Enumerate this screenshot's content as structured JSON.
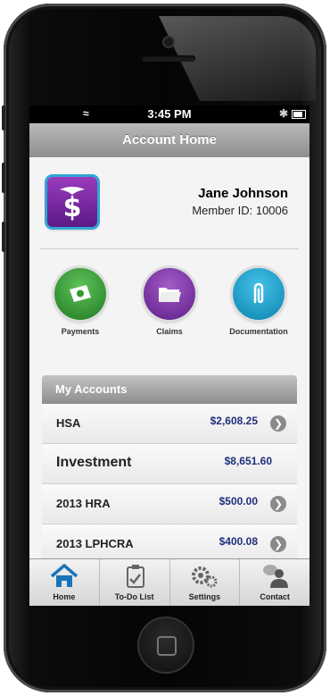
{
  "status_bar": {
    "time": "3:45 PM"
  },
  "nav": {
    "title": "Account Home"
  },
  "profile": {
    "name": "Jane Johnson",
    "member_id": "Member ID: 10006"
  },
  "actions": [
    {
      "label": "Payments",
      "icon": "payments-icon",
      "color": "#2f9b2e"
    },
    {
      "label": "Claims",
      "icon": "claims-icon",
      "color": "#7a2ea3"
    },
    {
      "label": "Documentation",
      "icon": "documentation-icon",
      "color": "#1a9fd0"
    }
  ],
  "accounts": {
    "header": "My Accounts",
    "rows": [
      {
        "name": "HSA",
        "value": "$2,608.25"
      },
      {
        "name": "Investment",
        "value": "$8,651.60"
      },
      {
        "name": "2013 HRA",
        "value": "$500.00"
      },
      {
        "name": "2013 LPHCRA",
        "value": "$400.08"
      }
    ]
  },
  "tabbar": {
    "items": [
      {
        "label": "Home",
        "icon": "home-icon",
        "active": true
      },
      {
        "label": "To-Do List",
        "icon": "todo-icon"
      },
      {
        "label": "Settings",
        "icon": "settings-icon"
      },
      {
        "label": "Contact",
        "icon": "contact-icon"
      }
    ]
  },
  "colors": {
    "accent_blue": "#1f2f7a",
    "tab_active": "#1a73b8"
  }
}
